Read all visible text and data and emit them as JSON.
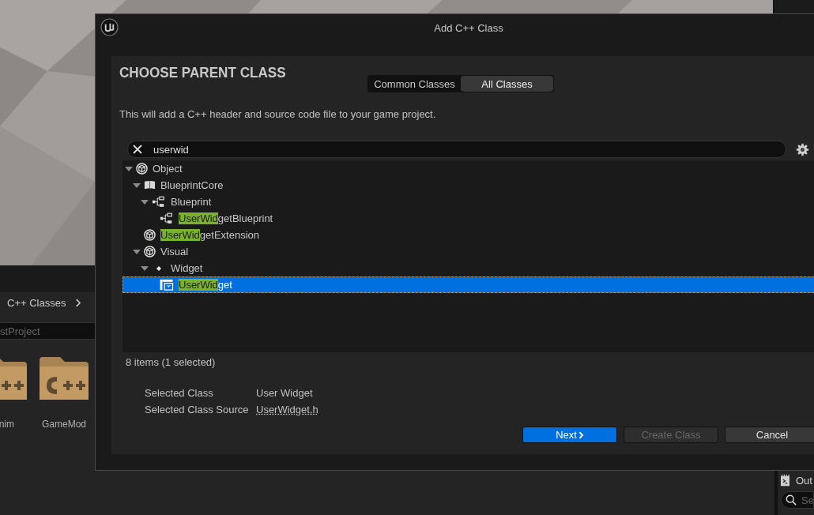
{
  "content_browser": {
    "breadcrumb": [
      "C++ Classes"
    ],
    "search": {
      "placeholder": "stProject"
    },
    "folders": [
      {
        "label": "nim"
      },
      {
        "label": "GameMod"
      }
    ]
  },
  "output_panel": {
    "title": "Out",
    "search": {
      "placeholder": "Se"
    }
  },
  "dialog": {
    "title": "Add C++ Class",
    "heading": "CHOOSE PARENT CLASS",
    "tabs": [
      {
        "label": "Common Classes",
        "selected": false
      },
      {
        "label": "All Classes",
        "selected": true
      }
    ],
    "description": "This will add a C++ header and source code file to your game project.",
    "search": {
      "value": "userwid"
    },
    "tree": [
      {
        "text": "Object",
        "kind": "class",
        "expanded": true,
        "selected": false,
        "children": [
          {
            "text": "BlueprintCore",
            "kind": "book",
            "expanded": true,
            "selected": false,
            "children": [
              {
                "text": "Blueprint",
                "kind": "blueprint",
                "expanded": true,
                "selected": false,
                "children": [
                  {
                    "match": "UserWid",
                    "text": "getBlueprint",
                    "kind": "blueprint",
                    "selected": false
                  }
                ]
              }
            ]
          },
          {
            "match": "UserWid",
            "text": "getExtension",
            "kind": "class",
            "selected": false
          },
          {
            "text": "Visual",
            "kind": "class",
            "expanded": true,
            "selected": false,
            "children": [
              {
                "text": "Widget",
                "kind": "dot",
                "expanded": true,
                "selected": false,
                "children": [
                  {
                    "match": "UserWid",
                    "text": "get",
                    "kind": "widget",
                    "selected": true
                  }
                ]
              }
            ]
          }
        ]
      }
    ],
    "status": "8 items (1 selected)",
    "details": [
      {
        "label": "Selected Class",
        "value": "User Widget",
        "link": false
      },
      {
        "label": "Selected Class Source",
        "value": "UserWidget.h",
        "link": true
      }
    ],
    "buttons": [
      {
        "label": "Next",
        "primary": true,
        "disabled": false,
        "chevron": true
      },
      {
        "label": "Create Class",
        "primary": false,
        "disabled": true,
        "chevron": false
      },
      {
        "label": "Cancel",
        "primary": false,
        "disabled": false,
        "chevron": false
      }
    ]
  }
}
